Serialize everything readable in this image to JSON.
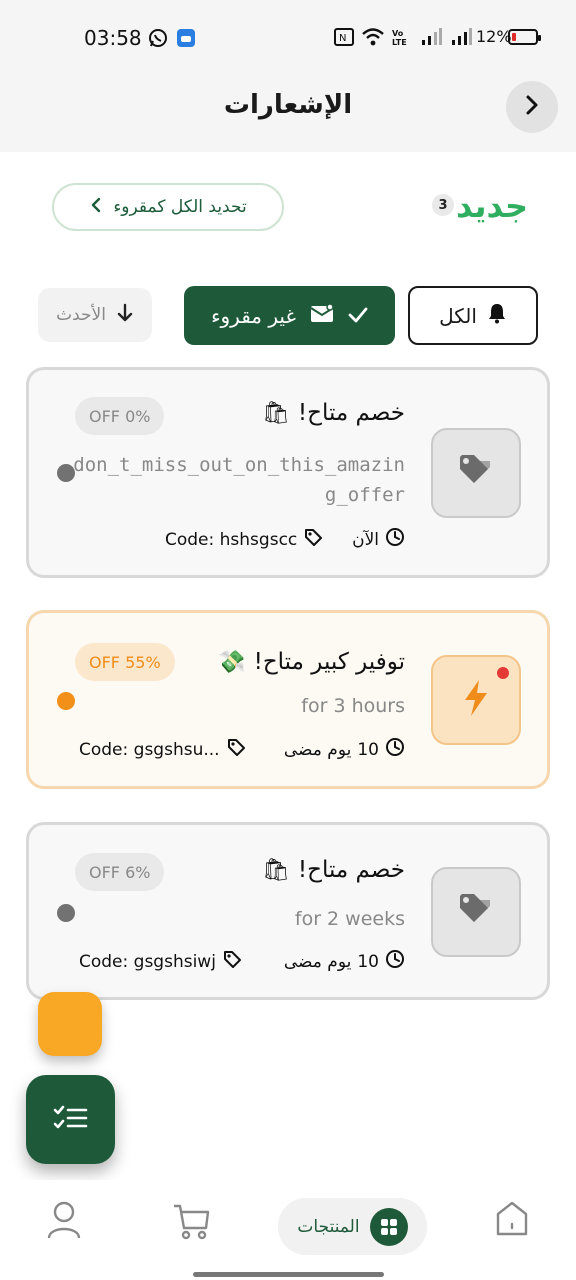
{
  "status_bar": {
    "time": "03:58",
    "battery_percent": "12%",
    "icons": [
      "whatsapp-icon",
      "app-icon",
      "nfc-icon",
      "wifi-icon",
      "volte-icon",
      "signal-icon",
      "signal-icon",
      "battery-icon"
    ]
  },
  "header": {
    "title": "الإشعارات",
    "back_icon": "chevron-right-icon"
  },
  "toolbar": {
    "mark_all_label": "تحديد الكل كمقروء",
    "new_label": "جديد",
    "new_count": "3"
  },
  "filters": {
    "sort_label": "الأحدث",
    "unread_label": "غير مقروء",
    "all_label": "الكل",
    "active": "unread"
  },
  "notifications": [
    {
      "title": "خصم متاح!",
      "emoji": "🛍️",
      "badge": "OFF 0%",
      "description": "don_t_miss_out_on_this_amazing_offer",
      "time": "الآن",
      "time_number": "",
      "code": "Code: hshsgscc",
      "icon": "tag-icon",
      "unread_dot": false
    },
    {
      "title": "توفير كبير متاح!",
      "emoji": "💸",
      "badge": "OFF 55%",
      "description": "for 3 hours",
      "time": "يوم مضى",
      "time_number": "10",
      "code": "Code: gsgshsu...",
      "icon": "lightning-icon",
      "unread_dot": true
    },
    {
      "title": "خصم متاح!",
      "emoji": "🛍️",
      "badge": "OFF 6%",
      "description": "for 2 weeks",
      "time": "يوم مضى",
      "time_number": "10",
      "code": "Code: gsgshsiwj",
      "icon": "tag-icon",
      "unread_dot": false
    }
  ],
  "bottom_nav": {
    "products_label": "المنتجات",
    "items": [
      "home-icon",
      "products-grid-icon",
      "cart-icon",
      "profile-icon"
    ]
  },
  "colors": {
    "primary_green": "#1e5a3a",
    "accent_green": "#2fae5f",
    "orange": "#f9a826",
    "highlight_border": "#f6d7ad"
  }
}
